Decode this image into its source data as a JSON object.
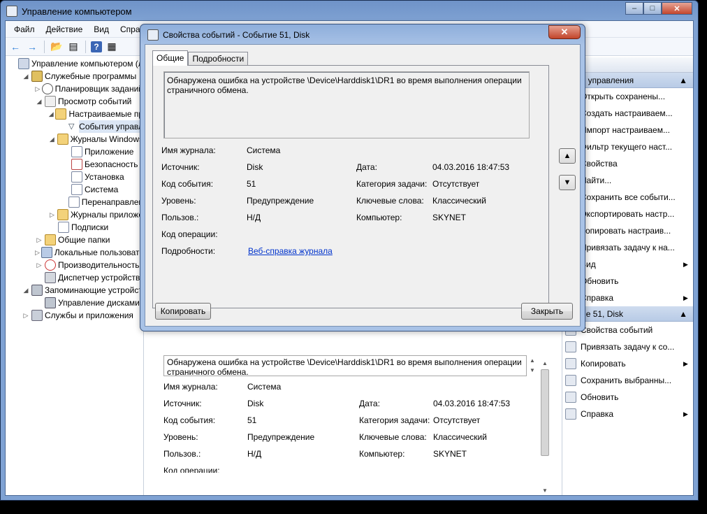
{
  "main_window": {
    "title": "Управление компьютером",
    "menu": [
      "Файл",
      "Действие",
      "Вид",
      "Справка"
    ]
  },
  "tree": [
    {
      "label": "Управление компьютером (л",
      "level": 0,
      "icon": "computer-icon",
      "exp": "",
      "cls": "ic-computer"
    },
    {
      "label": "Служебные программы",
      "level": 1,
      "icon": "tools-icon",
      "exp": "◢",
      "cls": "ic-tools"
    },
    {
      "label": "Планировщик заданий",
      "level": 2,
      "icon": "clock-icon",
      "exp": "▷",
      "cls": "ic-clock"
    },
    {
      "label": "Просмотр событий",
      "level": 2,
      "icon": "event-viewer-icon",
      "exp": "◢",
      "cls": "ic-event"
    },
    {
      "label": "Настраиваемые пр",
      "level": 3,
      "icon": "folder-icon",
      "exp": "◢",
      "cls": "ic-folder"
    },
    {
      "label": "События управл",
      "level": 4,
      "icon": "filter-icon",
      "exp": "",
      "cls": "ic-filter",
      "selected": true
    },
    {
      "label": "Журналы Windows",
      "level": 3,
      "icon": "folder-icon",
      "exp": "◢",
      "cls": "ic-folder"
    },
    {
      "label": "Приложение",
      "level": 4,
      "icon": "log-icon",
      "exp": "",
      "cls": "ic-log"
    },
    {
      "label": "Безопасность",
      "level": 4,
      "icon": "log-icon",
      "exp": "",
      "cls": "ic-log-red"
    },
    {
      "label": "Установка",
      "level": 4,
      "icon": "log-icon",
      "exp": "",
      "cls": "ic-log"
    },
    {
      "label": "Система",
      "level": 4,
      "icon": "log-icon",
      "exp": "",
      "cls": "ic-log"
    },
    {
      "label": "Перенаправлен",
      "level": 4,
      "icon": "log-icon",
      "exp": "",
      "cls": "ic-log"
    },
    {
      "label": "Журналы приложе",
      "level": 3,
      "icon": "folder-icon",
      "exp": "▷",
      "cls": "ic-folder"
    },
    {
      "label": "Подписки",
      "level": 3,
      "icon": "subscription-icon",
      "exp": "",
      "cls": "ic-log"
    },
    {
      "label": "Общие папки",
      "level": 2,
      "icon": "shared-folder-icon",
      "exp": "▷",
      "cls": "ic-share"
    },
    {
      "label": "Локальные пользовате",
      "level": 2,
      "icon": "users-icon",
      "exp": "▷",
      "cls": "ic-users"
    },
    {
      "label": "Производительность",
      "level": 2,
      "icon": "performance-icon",
      "exp": "▷",
      "cls": "ic-perf"
    },
    {
      "label": "Диспетчер устройств",
      "level": 2,
      "icon": "device-manager-icon",
      "exp": "",
      "cls": "ic-dev"
    },
    {
      "label": "Запоминающие устройст",
      "level": 1,
      "icon": "storage-icon",
      "exp": "◢",
      "cls": "ic-disk"
    },
    {
      "label": "Управление дисками",
      "level": 2,
      "icon": "disk-icon",
      "exp": "",
      "cls": "ic-disk"
    },
    {
      "label": "Службы и приложения",
      "level": 1,
      "icon": "services-icon",
      "exp": "▷",
      "cls": "ic-svc"
    }
  ],
  "actions": {
    "header": "твия",
    "section1": "ытия управления",
    "items1": [
      {
        "label": "Открыть сохранены...",
        "icon": "open-icon",
        "arrow": false
      },
      {
        "label": "Создать настраиваем...",
        "icon": "create-icon",
        "arrow": false
      },
      {
        "label": "Импорт настраиваем...",
        "icon": "import-icon",
        "arrow": false
      },
      {
        "label": "Фильтр текущего наст...",
        "icon": "filter-icon",
        "arrow": false
      },
      {
        "label": "Свойства",
        "icon": "properties-icon",
        "arrow": false
      },
      {
        "label": "Найти...",
        "icon": "find-icon",
        "arrow": false
      },
      {
        "label": "Сохранить все событи...",
        "icon": "save-icon",
        "arrow": false
      },
      {
        "label": "Экспортировать настр...",
        "icon": "export-icon",
        "arrow": false
      },
      {
        "label": "Копировать настраив...",
        "icon": "copy-icon",
        "arrow": false
      },
      {
        "label": "Привязать задачу к на...",
        "icon": "task-icon",
        "arrow": false
      },
      {
        "label": "Вид",
        "icon": "view-icon",
        "arrow": true
      },
      {
        "label": "Обновить",
        "icon": "refresh-icon",
        "arrow": false
      },
      {
        "label": "Справка",
        "icon": "help-icon",
        "arrow": true
      }
    ],
    "section2": "бытие 51, Disk",
    "items2": [
      {
        "label": "Свойства событий",
        "icon": "event-properties-icon",
        "arrow": false
      },
      {
        "label": "Привязать задачу к со...",
        "icon": "task-icon",
        "arrow": false
      },
      {
        "label": "Копировать",
        "icon": "copy-icon",
        "arrow": true
      },
      {
        "label": "Сохранить выбранны...",
        "icon": "save-icon",
        "arrow": false
      },
      {
        "label": "Обновить",
        "icon": "refresh-icon",
        "arrow": false
      },
      {
        "label": "Справка",
        "icon": "help-icon",
        "arrow": true
      }
    ]
  },
  "lower_detail": {
    "message": "Обнаружена ошибка на устройстве \\Device\\Harddisk1\\DR1 во время выполнения операции страничного обмена.",
    "labels": {
      "log_name": "Имя журнала:",
      "source": "Источник:",
      "event_id": "Код события:",
      "level": "Уровень:",
      "user": "Пользов.:",
      "opcode": "Код операции:",
      "date": "Дата:",
      "task_category": "Категория задачи:",
      "keywords": "Ключевые слова:",
      "computer": "Компьютер:"
    },
    "values": {
      "log_name": "Система",
      "source": "Disk",
      "event_id": "51",
      "level": "Предупреждение",
      "user": "Н/Д",
      "date": "04.03.2016 18:47:53",
      "task_category": "Отсутствует",
      "keywords": "Классический",
      "computer": "SKYNET"
    }
  },
  "dialog": {
    "title": "Свойства событий - Событие 51, Disk",
    "tabs": [
      "Общие",
      "Подробности"
    ],
    "message": "Обнаружена ошибка на устройстве \\Device\\Harddisk1\\DR1 во время выполнения операции страничного обмена.",
    "labels": {
      "log_name": "Имя журнала:",
      "source": "Источник:",
      "event_id": "Код события:",
      "level": "Уровень:",
      "user": "Пользов.:",
      "opcode": "Код операции:",
      "details": "Подробности:",
      "date": "Дата:",
      "task_category": "Категория задачи:",
      "keywords": "Ключевые слова:",
      "computer": "Компьютер:"
    },
    "values": {
      "log_name": "Система",
      "source": "Disk",
      "event_id": "51",
      "level": "Предупреждение",
      "user": "Н/Д",
      "opcode": "",
      "details_link": "Веб-справка журнала ",
      "date": "04.03.2016 18:47:53",
      "task_category": "Отсутствует",
      "keywords": "Классический",
      "computer": "SKYNET"
    },
    "copy_button": "Копировать",
    "close_button": "Закрыть"
  }
}
